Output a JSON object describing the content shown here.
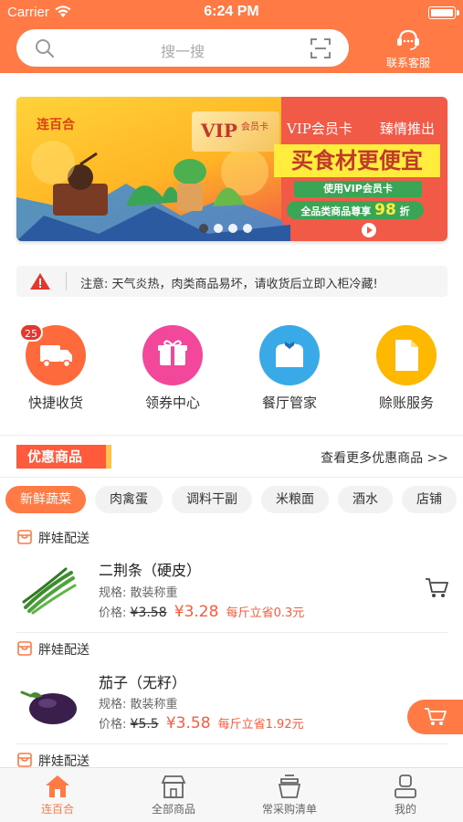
{
  "status_bar": {
    "carrier": "Carrier",
    "time": "6:24 PM"
  },
  "header": {
    "search_placeholder": "搜一搜",
    "service_label": "联系客服"
  },
  "banner": {
    "brand": "连百合",
    "vip_card_label": "VIP",
    "vip_card_sub": "会员卡",
    "headline": "VIP会员卡",
    "tag": "臻情推出",
    "main_text": "买食材更便宜",
    "chip_text": "使用VIP会员卡",
    "discount_prefix": "全品类商品尊享",
    "discount_value": "98",
    "discount_suffix": "折",
    "active_slide": 1,
    "slide_count": 4
  },
  "notice": {
    "text": "注意: 天气炎热，肉类商品易坏，请收货后立即入柜冷藏!"
  },
  "shortcuts": [
    {
      "label": "快捷收货",
      "color": "#ff6a3d",
      "badge": "25"
    },
    {
      "label": "领券中心",
      "color": "#f2479a"
    },
    {
      "label": "餐厅管家",
      "color": "#39a9e8"
    },
    {
      "label": "赊账服务",
      "color": "#ffb800"
    }
  ],
  "promo": {
    "title": "优惠商品",
    "more": "查看更多优惠商品  >>"
  },
  "categories": [
    "新鲜蔬菜",
    "肉禽蛋",
    "调料干副",
    "米粮面",
    "酒水",
    "店铺"
  ],
  "products": [
    {
      "seller": "胖娃配送",
      "name": "二荆条（硬皮）",
      "spec": "规格: 散装称重",
      "price_label": "价格:",
      "old_price": "¥3.58",
      "new_price": "¥3.28",
      "saving": "每斤立省0.3元"
    },
    {
      "seller": "胖娃配送",
      "name": "茄子（无籽）",
      "spec": "规格: 散装称重",
      "price_label": "价格:",
      "old_price": "¥5.5",
      "new_price": "¥3.58",
      "saving": "每斤立省1.92元"
    },
    {
      "seller": "胖娃配送"
    }
  ],
  "tabbar": [
    {
      "label": "连百合",
      "active": true
    },
    {
      "label": "全部商品"
    },
    {
      "label": "常采购清单"
    },
    {
      "label": "我的"
    }
  ],
  "colors": {
    "brand": "#ff7a45",
    "price": "#ff5a3c"
  }
}
